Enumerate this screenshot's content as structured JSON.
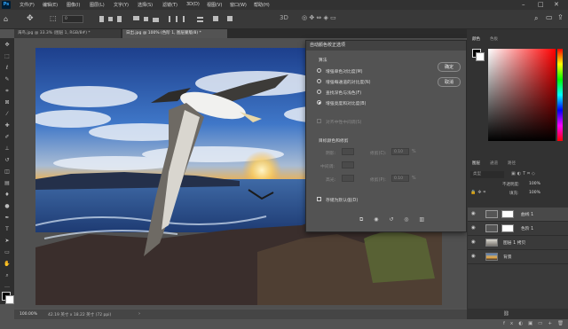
{
  "app": {
    "logo": "Ps"
  },
  "menubar": {
    "items": [
      "文件(F)",
      "编辑(E)",
      "图像(I)",
      "图层(L)",
      "文字(Y)",
      "选择(S)",
      "滤镜(T)",
      "3D(D)",
      "视图(V)",
      "窗口(W)",
      "帮助(H)"
    ]
  },
  "options": {
    "field_value": "0"
  },
  "tabs": [
    {
      "label": "海鸟.jpg @ 33.3% (图层 1, RGB/8#) *",
      "active": false
    },
    {
      "label": "日出.jpg @ 100% (色阶 1, 图层蒙版/8) *",
      "active": true
    }
  ],
  "color_panel": {
    "tabs": [
      "颜色",
      "色板"
    ],
    "accent": "#ff0000"
  },
  "layers_panel": {
    "tabs": [
      "图层",
      "通道",
      "路径"
    ],
    "kind_placeholder": "类型",
    "opacity_label": "不透明度:",
    "opacity_value": "100%",
    "fill_label": "填充:",
    "fill_value": "100%",
    "layers": [
      {
        "name": "曲线 1",
        "icon": "curves-adjustment-icon",
        "selected": true
      },
      {
        "name": "色阶 1",
        "icon": "levels-adjustment-icon",
        "selected": false
      },
      {
        "name": "图层 1 拷贝",
        "icon": "image-layer-icon",
        "selected": false
      },
      {
        "name": "背景",
        "icon": "image-layer-icon",
        "selected": false
      }
    ]
  },
  "dialog": {
    "title": "自动颜色校正选项",
    "algorithm_label": "算法",
    "options": [
      {
        "label": "增强单色对比度(M)",
        "selected": false
      },
      {
        "label": "增强每通道的对比度(N)",
        "selected": false
      },
      {
        "label": "查找深色与浅色(F)",
        "selected": false
      },
      {
        "label": "增强亮度和对比度(B)",
        "selected": true
      }
    ],
    "snap_neutral_label": "对齐中性中间调(S)",
    "target_label": "目标颜色和修剪",
    "rows": [
      {
        "label": "阴影:",
        "clip_label": "修剪(C):",
        "value": "0.10",
        "unit": "%"
      },
      {
        "label": "中间调:"
      },
      {
        "label": "高光:",
        "clip_label": "修剪(P):",
        "value": "0.10",
        "unit": "%"
      }
    ],
    "save_default_label": "存储为默认值(D)",
    "ok_label": "确定",
    "cancel_label": "取消"
  },
  "status": {
    "zoom": "100.00%",
    "doc_info": "42.19 英寸 x 18.22 英寸 (72 ppi)"
  }
}
